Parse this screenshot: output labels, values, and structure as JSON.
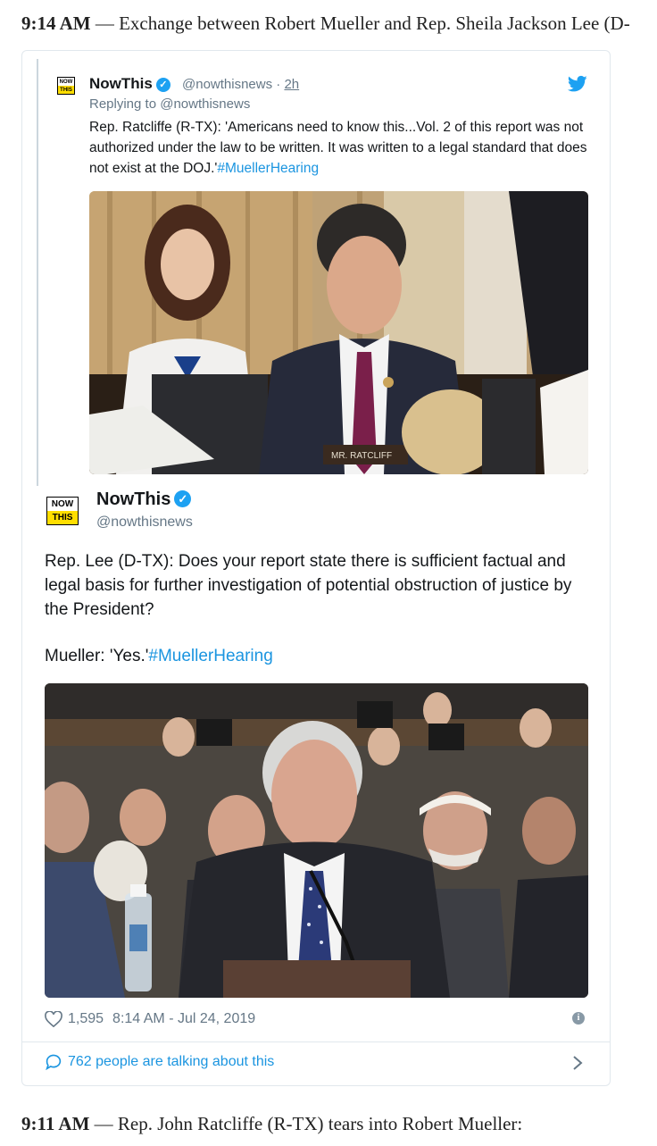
{
  "headline_top": {
    "time": "9:14 AM",
    "text": " — Exchange between Robert Mueller and Rep. Sheila Jackson Lee (D-"
  },
  "quoted_tweet": {
    "author_name": "NowThis",
    "handle": "@nowthisnews",
    "age": "2h",
    "replying_to": "Replying to @nowthisnews",
    "text": "Rep. Ratcliffe (R-TX): 'Americans need to know this...Vol. 2 of this report was not authorized under the law to be written. It was written to a legal standard that does not exist at the DOJ.'",
    "hashtag": "#MuellerHearing",
    "image_caption": "MR. RATCLIFF"
  },
  "main_tweet": {
    "author_name": "NowThis",
    "handle": "@nowthisnews",
    "paragraph1": "Rep. Lee (D-TX): Does your report state there is sufficient factual and legal basis for further investigation of potential obstruction of justice by the President?",
    "paragraph2": "Mueller: 'Yes.'",
    "hashtag": "#MuellerHearing",
    "likes": "1,595",
    "timestamp": "8:14 AM - Jul 24, 2019",
    "talking": "762 people are talking about this"
  },
  "logo": {
    "line1": "NOW",
    "line2": "THIS"
  },
  "headline_bottom": {
    "time": "9:11 AM",
    "text": " — Rep. John Ratcliffe (R-TX) tears into Robert Mueller:"
  },
  "icons": {
    "verified": "verified-icon",
    "bird": "twitter-bird-icon",
    "heart": "heart-icon",
    "info": "info-icon",
    "bubble": "speech-bubble-icon",
    "chevron": "chevron-right-icon"
  },
  "colors": {
    "link": "#1b95e0",
    "twitter_blue": "#1da1f2",
    "secondary_text": "#657786",
    "logo_yellow": "#ffde00"
  }
}
